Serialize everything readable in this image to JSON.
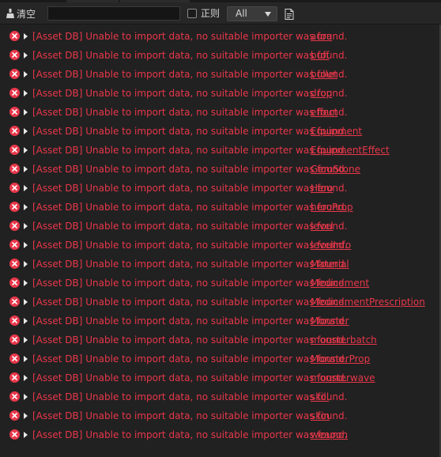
{
  "toolbar": {
    "clear_label": "清空",
    "search": {
      "value": "",
      "placeholder": ""
    },
    "regex_label": "正则",
    "regex_checked": false,
    "level_filter": {
      "selected": "All"
    }
  },
  "log": {
    "error_color": "#e8374a",
    "message": "[Asset DB] Unable to import data, no suitable importer was found.",
    "assets": [
      "aura",
      "buff",
      "bullet",
      "drop",
      "effect",
      "Equipment",
      "EquipmentEffect",
      "GemStone",
      "Hero",
      "heroProp",
      "level",
      "levelInfo",
      "Material",
      "Medicament",
      "MedicamentPrescription",
      "Monster",
      "monsterbatch",
      "MonsterProp",
      "monsterwave",
      "skill",
      "skin",
      "weapon"
    ]
  }
}
